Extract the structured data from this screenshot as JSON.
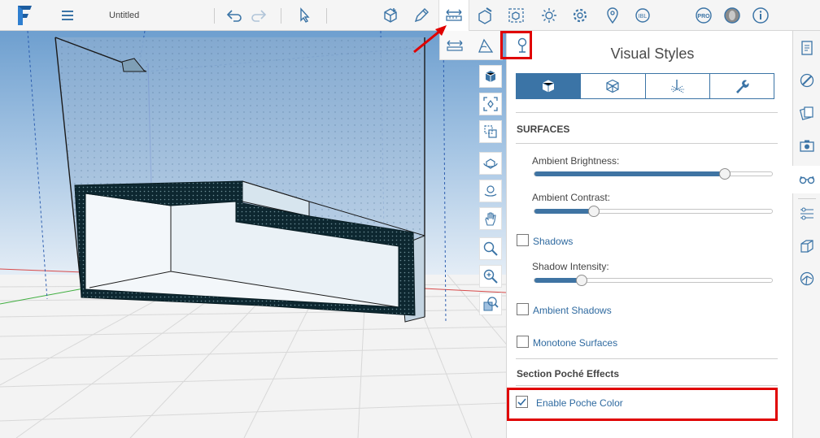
{
  "app": {
    "doc_title": "Untitled"
  },
  "toolbar": {
    "left": [
      "hamburger-icon",
      "undo-icon",
      "redo-icon",
      "select-icon"
    ],
    "center": [
      "cube-icon",
      "pencil-icon",
      "measure-icon",
      "solid-tools-icon",
      "group-icon",
      "sun-icon",
      "settings-icon",
      "location-icon",
      "ibl-icon"
    ],
    "right": [
      "pro-icon",
      "user-avatar-icon",
      "info-icon"
    ]
  },
  "panel": {
    "title": "Visual Styles",
    "tabs": [
      "surfaces-tab",
      "edges-tab",
      "grid-tab",
      "settings-tab"
    ],
    "surfaces_heading": "SURFACES",
    "ambient_brightness": {
      "label": "Ambient Brightness:",
      "value": 0.8
    },
    "ambient_contrast": {
      "label": "Ambient Contrast:",
      "value": 0.25
    },
    "shadows": {
      "label": "Shadows",
      "checked": false
    },
    "shadow_intensity": {
      "label": "Shadow Intensity:",
      "value": 0.2
    },
    "ambient_shadows": {
      "label": "Ambient Shadows",
      "checked": false
    },
    "monotone_surfaces": {
      "label": "Monotone Surfaces",
      "checked": false
    },
    "poche_heading": "Section Poché Effects",
    "enable_poche": {
      "label": "Enable Poche Color",
      "checked": true
    }
  },
  "colors": {
    "accent": "#3b74a6",
    "highlight": "#e00000",
    "sky": "#7ba8d3"
  }
}
